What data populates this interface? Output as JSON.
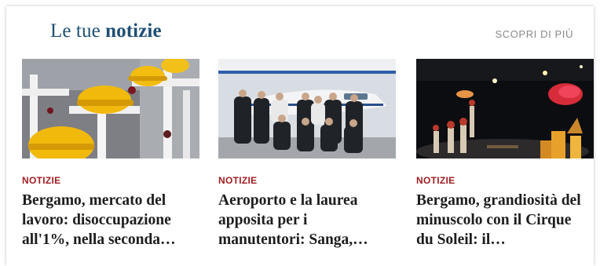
{
  "section": {
    "title_regular": "Le tue",
    "title_bold": "notizie",
    "more_link": "SCOPRI DI PIÙ"
  },
  "cards": [
    {
      "category": "NOTIZIE",
      "headline": "Bergamo, mercato del lavoro: disoccupazione all'1%, nella seconda…",
      "image": "crosses-with-yellow-hard-hats"
    },
    {
      "category": "NOTIZIE",
      "headline": "Aeroporto e la laurea apposita per i manutentori: Sanga,…",
      "image": "group-photo-in-front-of-private-jet"
    },
    {
      "category": "NOTIZIE",
      "headline": "Bergamo, grandiosità del minuscolo con il Cirque du Soleil: il…",
      "image": "cirque-du-soleil-stage-performance"
    }
  ]
}
